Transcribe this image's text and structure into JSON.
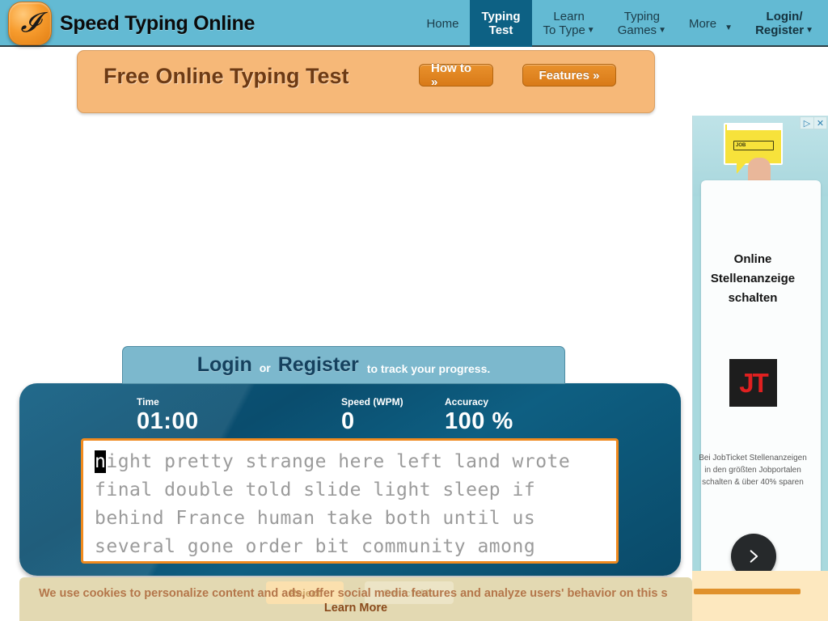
{
  "header": {
    "logo_icon": "italic-i-logo-icon",
    "brand": "Speed Typing Online",
    "nav": [
      {
        "line1": "Home",
        "line2": "",
        "caret": false,
        "active": false,
        "bold": false
      },
      {
        "line1": "Typing",
        "line2": "Test",
        "caret": false,
        "active": true,
        "bold": true
      },
      {
        "line1": "Learn",
        "line2": "To Type",
        "caret": true,
        "active": false,
        "bold": false
      },
      {
        "line1": "Typing",
        "line2": "Games",
        "caret": true,
        "active": false,
        "bold": false
      },
      {
        "line1": "More",
        "line2": "",
        "caret": true,
        "active": false,
        "bold": false
      },
      {
        "line1": "Login/",
        "line2": "Register",
        "caret": true,
        "active": false,
        "bold": true
      }
    ]
  },
  "promo": {
    "title": "Free Online Typing Test",
    "how_to_label": "How to »",
    "features_label": "Features »"
  },
  "login_banner": {
    "login": "Login",
    "or": "or",
    "register": "Register",
    "tail": "to track your progress."
  },
  "test": {
    "stats": [
      {
        "label": "Time",
        "value": "01:00"
      },
      {
        "label": "Speed (WPM)",
        "value": "0"
      },
      {
        "label": "Accuracy",
        "value": "100 %"
      }
    ],
    "cursor_char": "n",
    "prompt_text": "ight pretty strange here left land wrote final double told slide light sleep if behind France human take both until us several gone order bit community among",
    "prompt_lines": [
      "ight pretty strange here left land wrote",
      "final double told slide light sleep if",
      "behind France human take both until us",
      "several gone order bit community among"
    ]
  },
  "ad": {
    "play_icon": "play-triangle-icon",
    "close_icon": "close-x-icon",
    "balloon_search_text": "JOB",
    "headline": "Online Stellenanzeige schalten",
    "logo_text": "JT",
    "body": "Bei JobTicket Stellenanzeigen in den größten Jobportalen schalten & über 40% sparen",
    "next_icon": "chevron-right-icon"
  },
  "cookie": {
    "text": "We use cookies to personalize content and ads, offer social media features and analyze users' behavior on this s",
    "learn_more": "Learn More",
    "ghost_button_1": "Reject",
    "ghost_button_2": "Switch Me"
  },
  "colors": {
    "header_bg": "#63bad3",
    "nav_active": "#0d6184",
    "promo_bg": "#f6b878",
    "promo_btn": "#e9912c",
    "panel_blue": "#0b5275",
    "typebox_border": "#f08a1e",
    "cookie_bg": "#e3d9b2",
    "ad_bg": "#a9d9de"
  }
}
